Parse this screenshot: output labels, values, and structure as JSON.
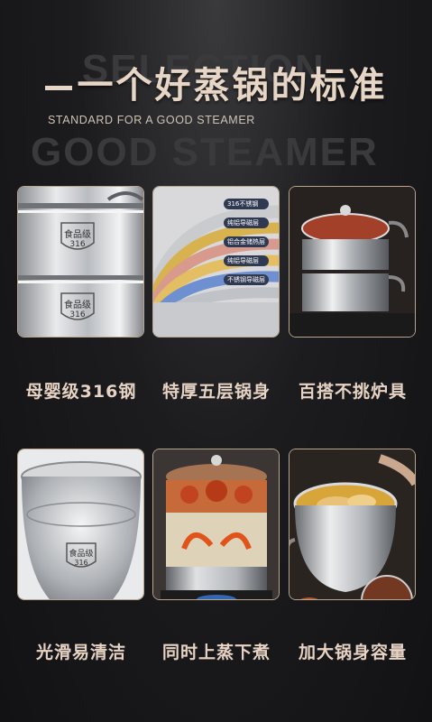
{
  "header": {
    "bg_text_line1": "SELECTION",
    "bg_text_line2": "GOOD STEAMER",
    "title": "一个好蒸锅的标准",
    "subtitle": "STANDARD FOR A GOOD STEAMER"
  },
  "features": [
    {
      "caption": "母婴级316钢",
      "badge_text": "食品级",
      "badge_number": "316"
    },
    {
      "caption": "特厚五层锅身",
      "layers": [
        "316不锈钢",
        "纯铝导磁层",
        "铝合金储热层",
        "纯铝导磁层",
        "不锈钢导磁层"
      ]
    },
    {
      "caption": "百搭不挑炉具"
    },
    {
      "caption": "光滑易清洁",
      "badge_text": "食品级",
      "badge_number": "316"
    },
    {
      "caption": "同时上蒸下煮"
    },
    {
      "caption": "加大锅身容量"
    }
  ],
  "colors": {
    "accent": "#e6d3c3",
    "card_border": "#b9a58e",
    "background": "#141416"
  }
}
